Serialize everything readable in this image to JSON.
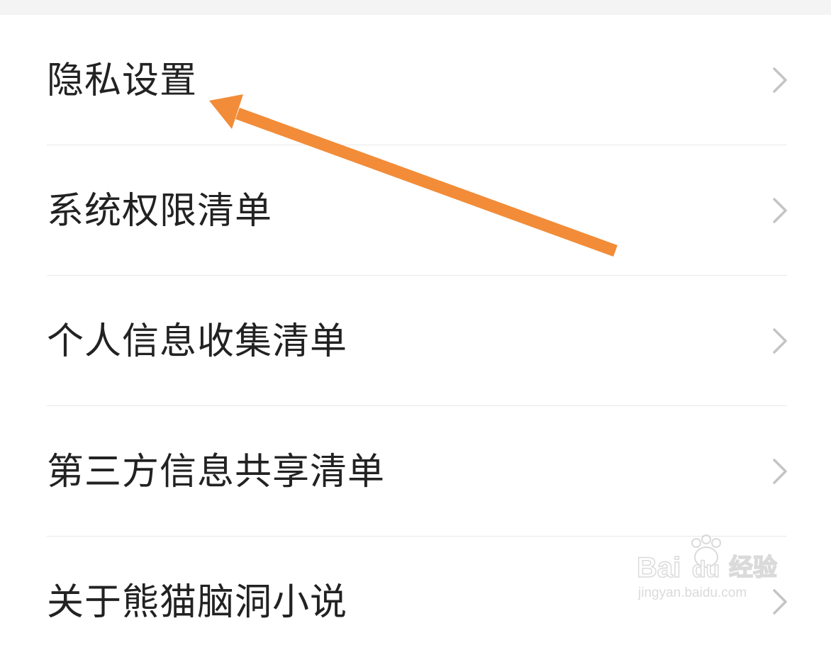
{
  "menu": {
    "items": [
      {
        "label": "隐私设置"
      },
      {
        "label": "系统权限清单"
      },
      {
        "label": "个人信息收集清单"
      },
      {
        "label": "第三方信息共享清单"
      },
      {
        "label": "关于熊猫脑洞小说"
      }
    ]
  },
  "annotation": {
    "arrow_color": "#f28c38",
    "points_to": "隐私设置"
  },
  "watermark": {
    "brand": "Baidu经验",
    "url": "jingyan.baidu.com"
  },
  "colors": {
    "text": "#222222",
    "chevron": "#c4c4c4",
    "divider": "#e9e9e9",
    "top_strip": "#f4f4f4"
  }
}
